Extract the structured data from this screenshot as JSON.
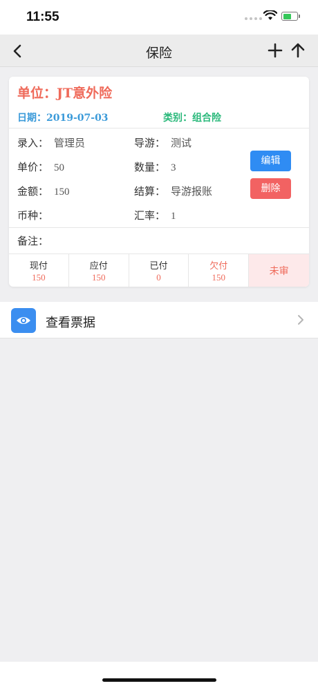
{
  "status_bar": {
    "time": "11:55"
  },
  "nav": {
    "title": "保险"
  },
  "record": {
    "unit_label": "单位：",
    "unit_value": "JT意外险",
    "date_label": "日期：",
    "date_value": "2019-07-03",
    "category_label": "类别：",
    "category_value": "组合险",
    "entry_label": "录入：",
    "entry_value": "管理员",
    "guide_label": "导游：",
    "guide_value": "测试",
    "price_label": "单价：",
    "price_value": "50",
    "quantity_label": "数量：",
    "quantity_value": "3",
    "amount_label": "金额：",
    "amount_value": "150",
    "settlement_label": "结算：",
    "settlement_value": "导游报账",
    "currency_label": "币种：",
    "currency_value": "",
    "rate_label": "汇率：",
    "rate_value": "1",
    "note_label": "备注：",
    "note_value": "",
    "edit_button": "编辑",
    "delete_button": "删除"
  },
  "payments": {
    "cash_label": "现付",
    "cash_value": "150",
    "payable_label": "应付",
    "payable_value": "150",
    "paid_label": "已付",
    "paid_value": "0",
    "owed_label": "欠付",
    "owed_value": "150",
    "status": "未审"
  },
  "tickets": {
    "label": "查看票据",
    "icon": "eye-icon"
  },
  "colors": {
    "accent_red": "#ef6a5a",
    "accent_blue": "#3a9ad9",
    "accent_green": "#29b87a",
    "edit_button": "#2f8cf3",
    "delete_button": "#f26262"
  }
}
